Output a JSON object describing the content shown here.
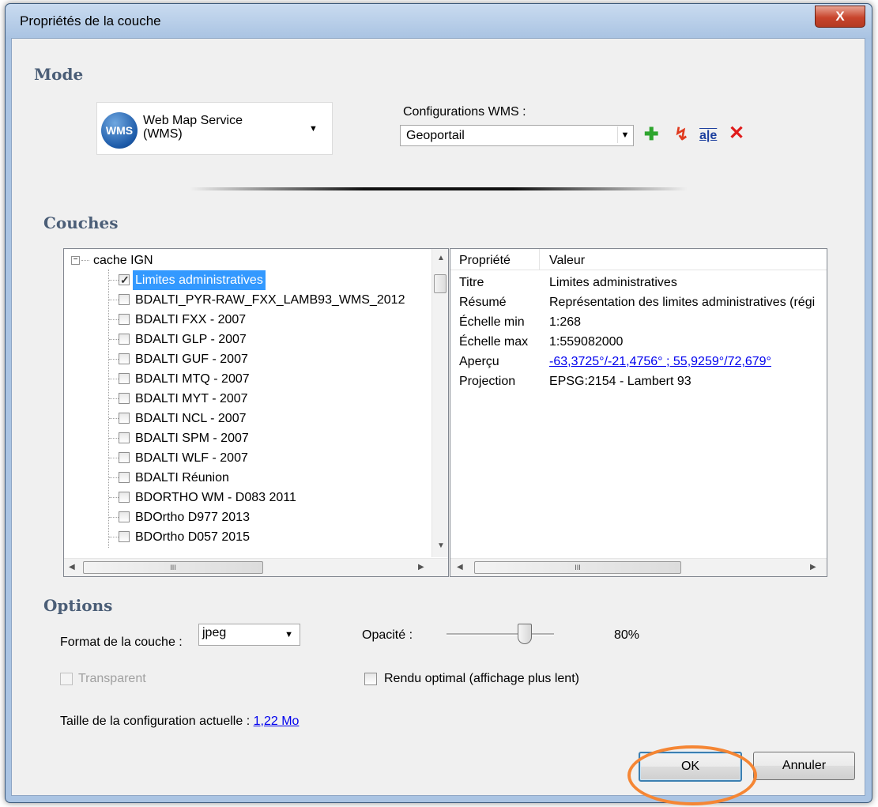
{
  "window": {
    "title": "Propriétés de la couche",
    "close_glyph": "X"
  },
  "mode": {
    "section_title": "Mode",
    "selected_label": "Web Map Service (WMS)",
    "logo_text": "WMS"
  },
  "wms_configs": {
    "label": "Configurations WMS :",
    "selected": "Geoportail",
    "toolbar": [
      {
        "name": "add-config-icon",
        "glyph": "✚",
        "color": "#2ea52e"
      },
      {
        "name": "refresh-config-icon",
        "glyph": "↯",
        "color": "#e03a1e"
      },
      {
        "name": "rename-config-icon",
        "glyph": "a|e",
        "color": "#1c3f9e"
      },
      {
        "name": "delete-config-icon",
        "glyph": "✕",
        "color": "#e01b1b"
      }
    ]
  },
  "layers": {
    "section_title": "Couches",
    "root": "cache IGN",
    "items": [
      {
        "label": "Limites administratives",
        "checked": true,
        "selected": true
      },
      {
        "label": "BDALTI_PYR-RAW_FXX_LAMB93_WMS_2012",
        "checked": false
      },
      {
        "label": "BDALTI FXX - 2007",
        "checked": false
      },
      {
        "label": "BDALTI GLP - 2007",
        "checked": false
      },
      {
        "label": "BDALTI GUF - 2007",
        "checked": false
      },
      {
        "label": "BDALTI MTQ - 2007",
        "checked": false
      },
      {
        "label": "BDALTI MYT - 2007",
        "checked": false
      },
      {
        "label": "BDALTI NCL - 2007",
        "checked": false
      },
      {
        "label": "BDALTI SPM - 2007",
        "checked": false
      },
      {
        "label": "BDALTI WLF - 2007",
        "checked": false
      },
      {
        "label": "BDALTI Réunion",
        "checked": false
      },
      {
        "label": "BDORTHO WM - D083 2011",
        "checked": false
      },
      {
        "label": "BDOrtho D977 2013",
        "checked": false
      },
      {
        "label": "BDOrtho D057 2015",
        "checked": false
      }
    ],
    "hscroll_thumb": "III"
  },
  "properties": {
    "headers": [
      "Propriété",
      "Valeur"
    ],
    "rows": [
      {
        "key": "Titre",
        "value": "Limites administratives",
        "link": false
      },
      {
        "key": "Résumé",
        "value": "Représentation des limites administratives (régi",
        "link": false
      },
      {
        "key": "Échelle min",
        "value": "1:268",
        "link": false
      },
      {
        "key": "Échelle max",
        "value": "1:559082000",
        "link": false
      },
      {
        "key": "Aperçu",
        "value": "-63,3725°/-21,4756° ; 55,9259°/72,679°",
        "link": true
      },
      {
        "key": "Projection",
        "value": "EPSG:2154 - Lambert 93",
        "link": false
      }
    ],
    "hscroll_thumb": "III"
  },
  "options": {
    "section_title": "Options",
    "format_label": "Format de la couche :",
    "format_value": "jpeg",
    "opacity_label": "Opacité :",
    "opacity_value": "80%",
    "transparent_label": "Transparent",
    "optimal_label": "Rendu optimal (affichage plus lent)",
    "size_label": "Taille de la configuration actuelle :",
    "size_value": "1,22 Mo"
  },
  "buttons": {
    "ok": "OK",
    "cancel": "Annuler"
  },
  "colors": {
    "highlight_ring": "#f58634",
    "selection": "#3399ff",
    "link": "#0000ee"
  }
}
